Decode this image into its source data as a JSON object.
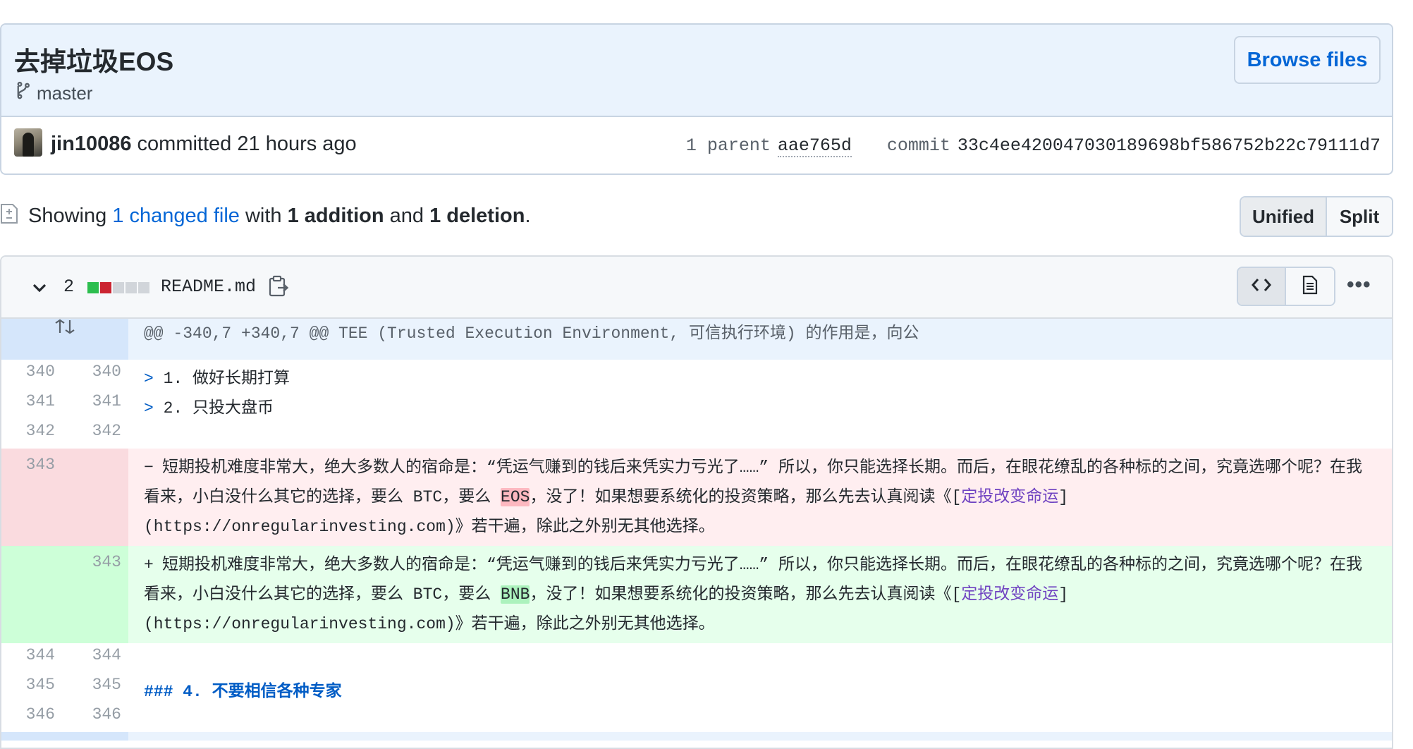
{
  "commit": {
    "title": "去掉垃圾EOS",
    "branch": "master",
    "browse_files_label": "Browse files",
    "author": "jin10086",
    "action": "committed",
    "time": "21 hours ago",
    "parent_label": "1 parent",
    "parent_sha": "aae765d",
    "commit_label": "commit",
    "commit_sha": "33c4ee420047030189698bf586752b22c79111d7"
  },
  "summary": {
    "showing": "Showing",
    "changed_files": "1 changed file",
    "with": "with",
    "additions": "1 addition",
    "and": "and",
    "deletions": "1 deletion",
    "period": ".",
    "unified_label": "Unified",
    "split_label": "Split"
  },
  "file": {
    "change_count": "2",
    "file_name": "README.md",
    "diffstat_colors": [
      "#2cbe4e",
      "#cb2431",
      "#d1d5da",
      "#d1d5da",
      "#d1d5da"
    ]
  },
  "hunk_header": "@@ -340,7 +340,7 @@ TEE (Trusted Execution Environment, 可信执行环境) 的作用是，向公",
  "lines": {
    "l340": {
      "old": "340",
      "new": "340",
      "marker": "> ",
      "text": "1. 做好长期打算"
    },
    "l341": {
      "old": "341",
      "new": "341",
      "marker": "> ",
      "text": "2. 只投大盘币"
    },
    "l342": {
      "old": "342",
      "new": "342"
    },
    "del": {
      "old": "343",
      "sign": "−",
      "before": "短期投机难度非常大，绝大多数人的宿命是：“凭运气赚到的钱后来凭实力亏光了……” 所以，你只能选择长期。而后，在眼花缭乱的各种标的之间，究竟选哪个呢？在我看来，小白没什么其它的选择，要么 BTC，要么 ",
      "highlight": "EOS",
      "after": "，没了！如果想要系统化的投资策略，那么先去认真阅读《[",
      "link": "定投改变命运",
      "tail": "](https://onregularinvesting.com)》若干遍，除此之外别无其他选择。"
    },
    "add": {
      "new": "343",
      "sign": "+",
      "before": "短期投机难度非常大，绝大多数人的宿命是：“凭运气赚到的钱后来凭实力亏光了……” 所以，你只能选择长期。而后，在眼花缭乱的各种标的之间，究竟选哪个呢？在我看来，小白没什么其它的选择，要么 BTC，要么 ",
      "highlight": "BNB",
      "after": "，没了！如果想要系统化的投资策略，那么先去认真阅读《[",
      "link": "定投改变命运",
      "tail": "](https://onregularinvesting.com)》若干遍，除此之外别无其他选择。"
    },
    "l344": {
      "old": "344",
      "new": "344"
    },
    "l345": {
      "old": "345",
      "new": "345",
      "text": "### 4. 不要相信各种专家"
    },
    "l346": {
      "old": "346",
      "new": "346"
    }
  }
}
